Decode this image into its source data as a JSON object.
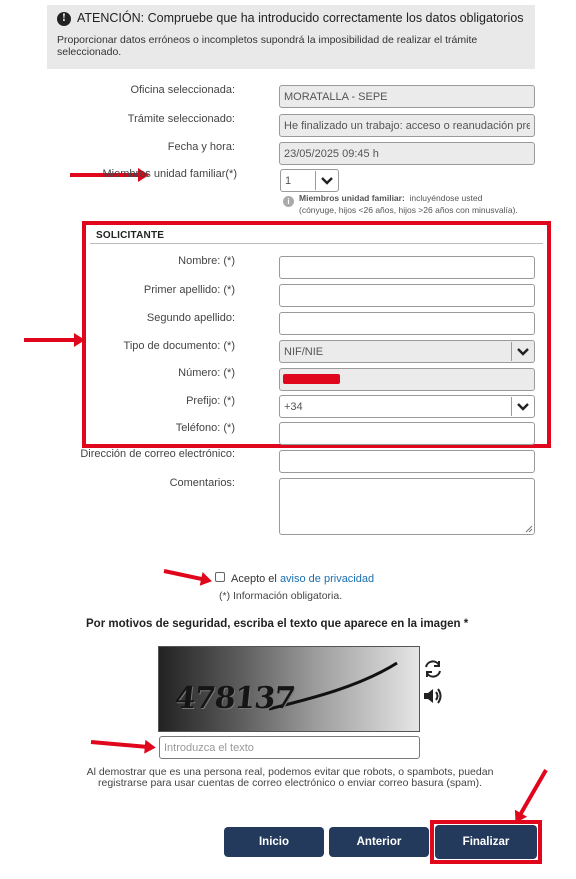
{
  "alert": {
    "icon": "exclamation-icon",
    "title": "ATENCIÓN: Compruebe que ha introducido correctamente los datos obligatorios",
    "text": "Proporcionar datos erróneos o incompletos supondrá la imposibilidad de realizar el trámite seleccionado."
  },
  "form": {
    "oficina_label": "Oficina seleccionada:",
    "oficina_value": "MORATALLA - SEPE",
    "tramite_label": "Trámite seleccionado:",
    "tramite_value": "He finalizado un trabajo: acceso o reanudación pre",
    "fecha_label": "Fecha y hora:",
    "fecha_value": "23/05/2025 09:45 h",
    "miembros_label": "Miembros unidad familiar(*)",
    "miembros_value": "1",
    "miembros_hint_bold": "Miembros unidad familiar:",
    "miembros_hint_text": "incluyéndose usted",
    "miembros_hint_line2": "(cónyuge, hijos <26 años, hijos >26 años con minusvalía)."
  },
  "solicitante": {
    "title": "SOLICITANTE",
    "nombre_label": "Nombre: (*)",
    "apellido1_label": "Primer apellido: (*)",
    "apellido2_label": "Segundo apellido:",
    "tipo_doc_label": "Tipo de documento: (*)",
    "tipo_doc_value": "NIF/NIE",
    "numero_label": "Número: (*)",
    "prefijo_label": "Prefijo: (*)",
    "prefijo_value": "+34",
    "telefono_label": "Teléfono: (*)"
  },
  "extra": {
    "email_label": "Dirección de correo electrónico:",
    "comentarios_label": "Comentarios:"
  },
  "privacy": {
    "prefix": "Acepto el",
    "link": "aviso de privacidad",
    "required_note": "(*) Información obligatoria."
  },
  "captcha": {
    "heading": "Por motivos de seguridad, escriba el texto que aparece en la imagen",
    "heading_mark": "*",
    "image_text": "478137",
    "input_placeholder": "Introduzca el texto",
    "note": "Al demostrar que es una persona real, podemos evitar que robots, o spambots, puedan registrarse para usar cuentas de correo electrónico o enviar correo basura (spam)."
  },
  "buttons": {
    "inicio": "Inicio",
    "anterior": "Anterior",
    "finalizar": "Finalizar"
  },
  "colors": {
    "annotation_red": "#e0061c",
    "button_navy": "#233a5c",
    "link_blue": "#1a6fb0"
  }
}
